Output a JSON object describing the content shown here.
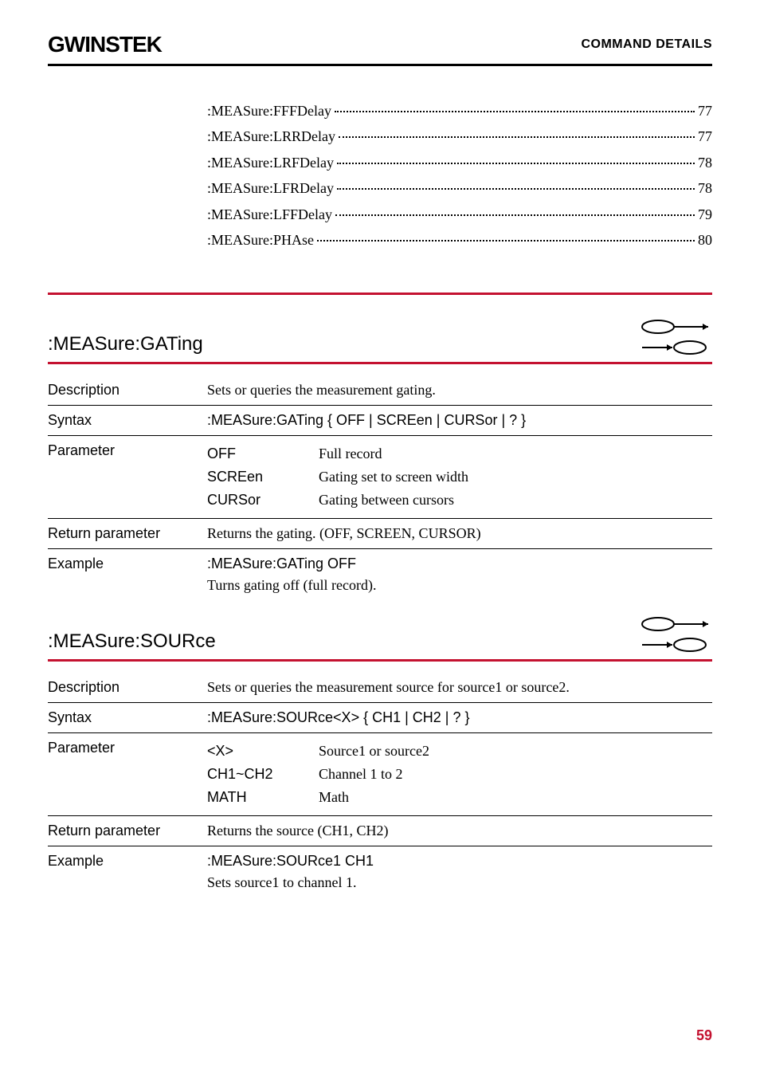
{
  "header": {
    "logo": "GWINSTEK",
    "right": "COMMAND DETAILS"
  },
  "toc": [
    {
      "label": ":MEASure:FFFDelay",
      "page": "77"
    },
    {
      "label": ":MEASure:LRRDelay",
      "page": "77"
    },
    {
      "label": ":MEASure:LRFDelay",
      "page": "78"
    },
    {
      "label": ":MEASure:LFRDelay",
      "page": "78"
    },
    {
      "label": ":MEASure:LFFDelay",
      "page": "79"
    },
    {
      "label": ":MEASure:PHAse",
      "page": "80"
    }
  ],
  "sections": [
    {
      "title": ":MEASure:GATing",
      "rows": [
        {
          "label": "Description",
          "value": "Sets or queries the measurement gating."
        },
        {
          "label": "Syntax",
          "value": ":MEASure:GATing { OFF | SCREen | CURSor | ? }"
        }
      ],
      "param_label": "Parameter",
      "params": [
        {
          "key": "OFF",
          "val": "Full record"
        },
        {
          "key": "SCREen",
          "val": "Gating set to screen width"
        },
        {
          "key": "CURSor",
          "val": "Gating between cursors"
        }
      ],
      "return_row": {
        "label": "Return parameter",
        "value": "Returns the gating. (OFF, SCREEN, CURSOR)"
      },
      "example": {
        "label": "Example",
        "cmd": ":MEASure:GATing OFF",
        "desc": "Turns gating off (full record)."
      }
    },
    {
      "title": ":MEASure:SOURce",
      "rows": [
        {
          "label": "Description",
          "value": "Sets or queries the measurement source for source1 or source2."
        },
        {
          "label": "Syntax",
          "value": ":MEASure:SOURce<X> { CH1 | CH2 | ? }"
        }
      ],
      "param_label": "Parameter",
      "params": [
        {
          "key": "<X>",
          "val": "Source1 or source2"
        },
        {
          "key": "CH1~CH2",
          "val": "Channel 1 to 2"
        },
        {
          "key": "MATH",
          "val": "Math"
        }
      ],
      "return_row": {
        "label": "Return parameter",
        "value": "Returns the source (CH1, CH2)"
      },
      "example": {
        "label": "Example",
        "cmd": ":MEASure:SOURce1 CH1",
        "desc": "Sets source1 to channel 1."
      }
    }
  ],
  "page_number": "59"
}
